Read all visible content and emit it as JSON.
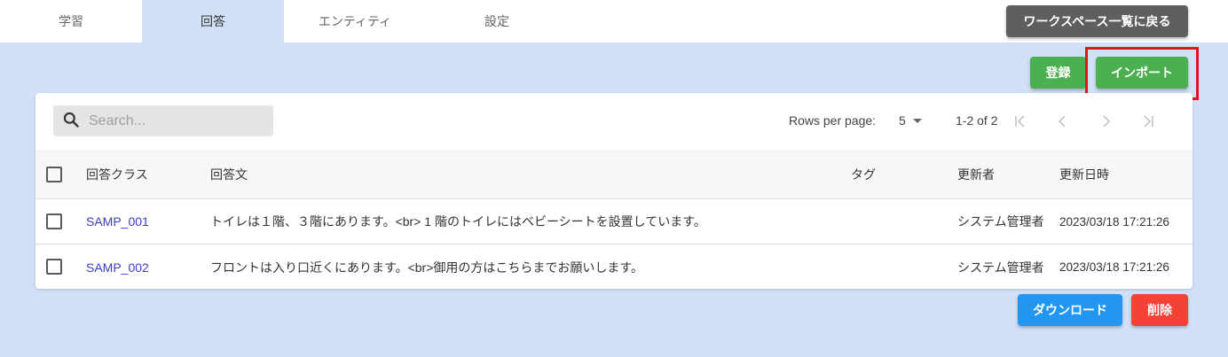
{
  "tabs": [
    {
      "label": "学習"
    },
    {
      "label": "回答"
    },
    {
      "label": "エンティティ"
    },
    {
      "label": "設定"
    }
  ],
  "active_tab": "回答",
  "header": {
    "back_label": "ワークスペース一覧に戻る"
  },
  "actions": {
    "register_label": "登録",
    "import_label": "インポート"
  },
  "search": {
    "placeholder": "Search..."
  },
  "pagination": {
    "rows_label": "Rows per page:",
    "rows_value": "5",
    "range": "1-2 of 2"
  },
  "table": {
    "headers": {
      "answer_class": "回答クラス",
      "answer_text": "回答文",
      "tag": "タグ",
      "updated_by": "更新者",
      "updated_at": "更新日時"
    },
    "rows": [
      {
        "answer_class": "SAMP_001",
        "answer_text": "トイレは１階、３階にあります。<br> 1 階のトイレにはベビーシートを設置しています。",
        "tag": "",
        "updated_by": "システム管理者",
        "updated_at": "2023/03/18 17:21:26"
      },
      {
        "answer_class": "SAMP_002",
        "answer_text": "フロントは入り口近くにあります。<br>御用の方はこちらまでお願いします。",
        "tag": "",
        "updated_by": "システム管理者",
        "updated_at": "2023/03/18 17:21:26"
      }
    ]
  },
  "footer": {
    "download_label": "ダウンロード",
    "delete_label": "削除"
  },
  "colors": {
    "accent_bg": "#d1e0f6",
    "green": "#4caf50",
    "blue": "#2196f3",
    "red": "#f44336",
    "highlight": "#e0141e"
  }
}
